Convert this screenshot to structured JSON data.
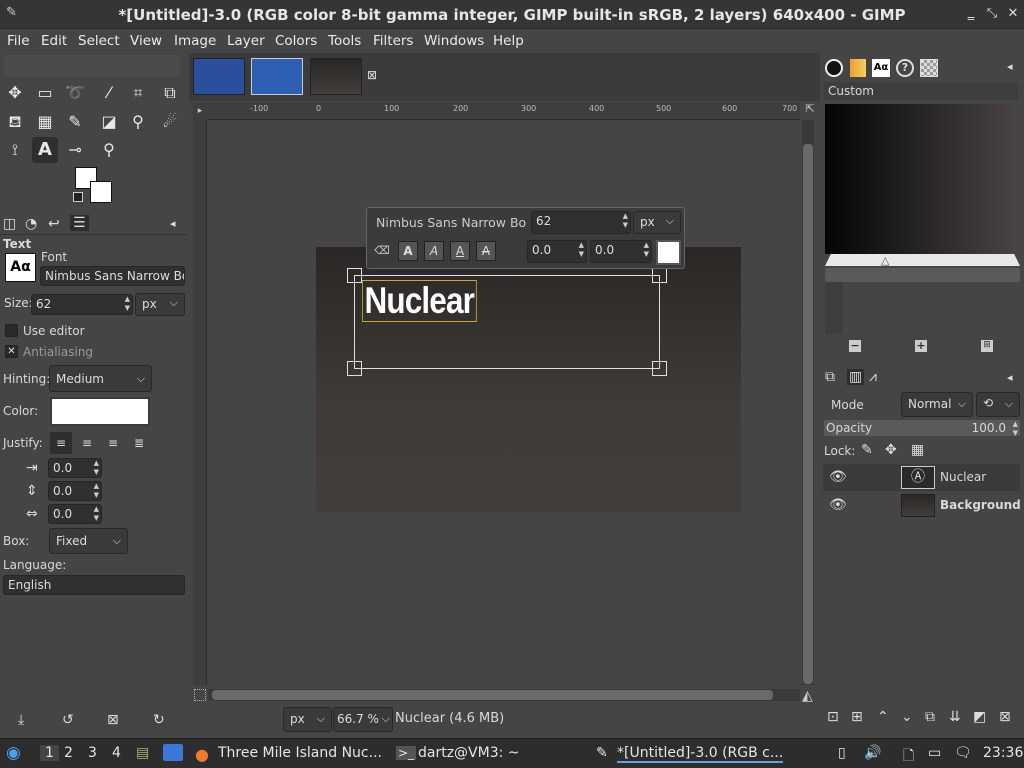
{
  "window": {
    "title": "*[Untitled]-3.0 (RGB color 8-bit gamma integer, GIMP built-in sRGB, 2 layers) 640x400 - GIMP"
  },
  "menu": [
    "File",
    "Edit",
    "Select",
    "View",
    "Image",
    "Layer",
    "Colors",
    "Tools",
    "Filters",
    "Windows",
    "Help"
  ],
  "tool_options": {
    "header": "Text",
    "font_label": "Font",
    "font_value": "Nimbus Sans Narrow Bold",
    "size_label": "Size:",
    "size_value": "62",
    "size_unit": "px",
    "use_editor": "Use editor",
    "antialiasing": "Antialiasing",
    "hinting_label": "Hinting:",
    "hinting_value": "Medium",
    "color_label": "Color:",
    "justify_label": "Justify:",
    "indent": "0.0",
    "line_spacing": "0.0",
    "letter_spacing": "0.0",
    "box_label": "Box:",
    "box_value": "Fixed",
    "language_label": "Language:",
    "language_value": "English"
  },
  "text_overlay": {
    "font": "Nimbus Sans Narrow Bo",
    "size": "62",
    "unit": "px",
    "baseline": "0.0",
    "kerning": "0.0"
  },
  "canvas": {
    "text": "Nuclear",
    "ruler_h": [
      "-100",
      "0",
      "100",
      "200",
      "300",
      "400",
      "500",
      "600",
      "700"
    ]
  },
  "statusbar": {
    "unit": "px",
    "zoom": "66.7 %",
    "status": "Nuclear (4.6 MB)"
  },
  "gradients": {
    "label": "Custom"
  },
  "layers": {
    "mode_label": "Mode",
    "mode_value": "Normal",
    "opacity_label": "Opacity",
    "opacity_value": "100.0",
    "lock_label": "Lock:",
    "items": [
      {
        "name": "Nuclear"
      },
      {
        "name": "Background"
      }
    ]
  },
  "taskbar": {
    "workspaces": [
      "1",
      "2",
      "3",
      "4"
    ],
    "tasks": [
      "Three Mile Island Nuc...",
      "dartz@VM3: ~",
      "*[Untitled]-3.0 (RGB c..."
    ],
    "clock": "23:36"
  }
}
